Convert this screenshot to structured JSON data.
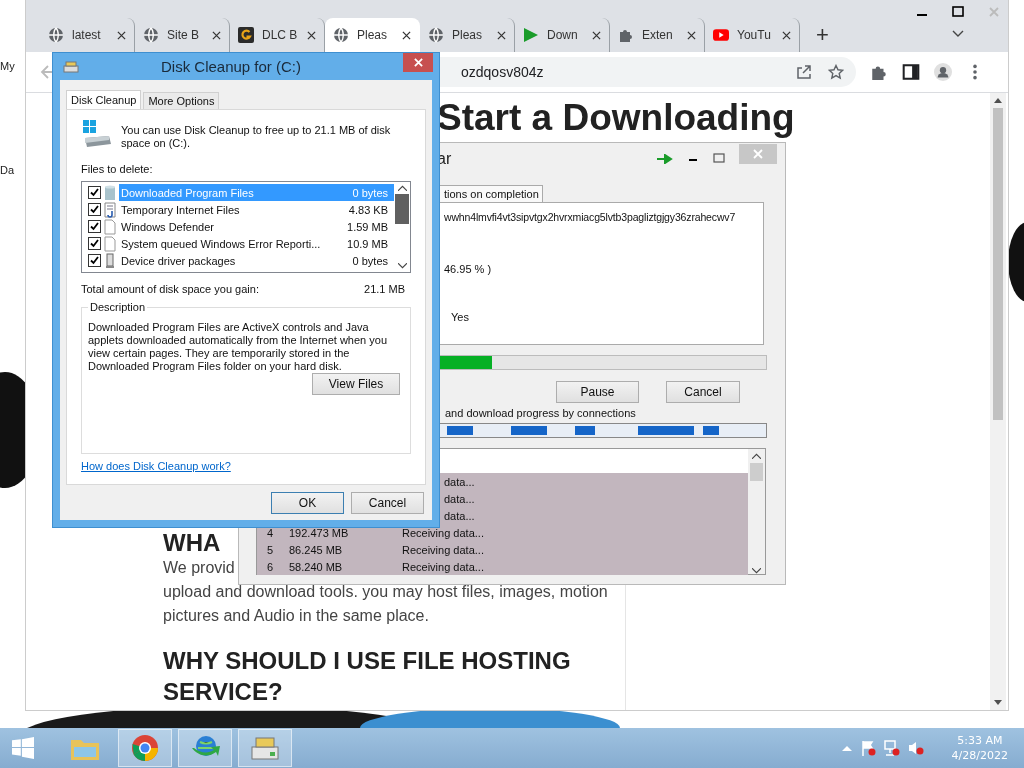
{
  "desktop": {
    "labels": [
      "My",
      "Da"
    ]
  },
  "browser": {
    "tabs": [
      {
        "title": "latest",
        "kind": "globe",
        "selected": false
      },
      {
        "title": "Site B",
        "kind": "globe",
        "selected": false
      },
      {
        "title": "DLC B",
        "kind": "logo",
        "selected": false
      },
      {
        "title": "Pleas",
        "kind": "globe",
        "selected": true
      },
      {
        "title": "Pleas",
        "kind": "globe",
        "selected": false
      },
      {
        "title": "Down",
        "kind": "play",
        "selected": false
      },
      {
        "title": "Exten",
        "kind": "puzzle",
        "selected": false
      },
      {
        "title": "YouTu",
        "kind": "video",
        "selected": false
      }
    ],
    "new_tab": "+",
    "address": "ozdqosv804z"
  },
  "page": {
    "heading": "Start a Downloading",
    "blocks": [
      {
        "kind": "heading",
        "text": "WHA"
      },
      {
        "kind": "paragraph",
        "text": "We provid"
      },
      {
        "kind": "paragraph",
        "text": "upload and download tools. you may host files, images, motion"
      },
      {
        "kind": "paragraph",
        "text": "pictures and Audio in the same place."
      },
      {
        "kind": "heading",
        "text": "WHY SHOULD I USE FILE HOSTING"
      },
      {
        "kind": "heading",
        "text": "SERVICE?"
      }
    ]
  },
  "download_window": {
    "title": "ar",
    "tab": "tions on completion",
    "url": "wwhn4lmvfi4vt3sipvtgx2hvrxmiacg5lvtb3pagliztgjgy36zrahecwv7",
    "percent": "46.95 % )",
    "resume": "Yes",
    "level": 0.4695,
    "buttons": [
      "Pause",
      "Cancel"
    ],
    "connections_label": "and download progress by connections",
    "rows": [
      {
        "number": "",
        "size": "",
        "status": "data...",
        "selected": true
      },
      {
        "number": "",
        "size": "",
        "status": "data...",
        "selected": true
      },
      {
        "number": "",
        "size": "",
        "status": "data...",
        "selected": true
      },
      {
        "number": "4",
        "size": "192.473  MB",
        "status": "Receiving data...",
        "selected": true
      },
      {
        "number": "5",
        "size": "86.245  MB",
        "status": "Receiving data...",
        "selected": true
      },
      {
        "number": "6",
        "size": "58.240  MB",
        "status": "Receiving data...",
        "selected": true
      }
    ]
  },
  "dialog": {
    "title": "Disk Cleanup for  (C:)",
    "tabs": [
      {
        "label": "Disk Cleanup",
        "selected": true
      },
      {
        "label": "More Options",
        "selected": false
      }
    ],
    "intro": "You can use Disk Cleanup to free up to 21.1 MB of disk space on  (C:).",
    "files_label": "Files to delete:",
    "files": [
      {
        "name": "Downloaded Program Files",
        "size": "0 bytes",
        "checked": true,
        "selected": true,
        "kind": "cylinder"
      },
      {
        "name": "Temporary Internet Files",
        "size": "4.83 KB",
        "checked": true,
        "selected": false,
        "kind": "document"
      },
      {
        "name": "Windows Defender",
        "size": "1.59 MB",
        "checked": true,
        "selected": false,
        "kind": "blank"
      },
      {
        "name": "System queued Windows Error Reporti...",
        "size": "10.9 MB",
        "checked": true,
        "selected": false,
        "kind": "blank"
      },
      {
        "name": "Device driver packages",
        "size": "0 bytes",
        "checked": true,
        "selected": false,
        "kind": "device"
      }
    ],
    "total_label": "Total amount of disk space you gain:",
    "total": "21.1 MB",
    "description_label": "Description",
    "description": "Downloaded Program Files are ActiveX controls and Java applets downloaded automatically from the Internet when you view certain pages. They are temporarily stored in the Downloaded Program Files folder on your hard disk.",
    "view_files": "View Files",
    "link": "How does Disk Cleanup work?",
    "buttons": [
      "OK",
      "Cancel"
    ]
  },
  "taskbar": {
    "apps": [
      {
        "kind": "folder",
        "running": false
      },
      {
        "kind": "chrome",
        "running": true
      },
      {
        "kind": "globe-arrow",
        "running": true
      },
      {
        "kind": "drive",
        "running": true
      }
    ],
    "time": "5:33 AM",
    "date": "4/28/2022"
  }
}
